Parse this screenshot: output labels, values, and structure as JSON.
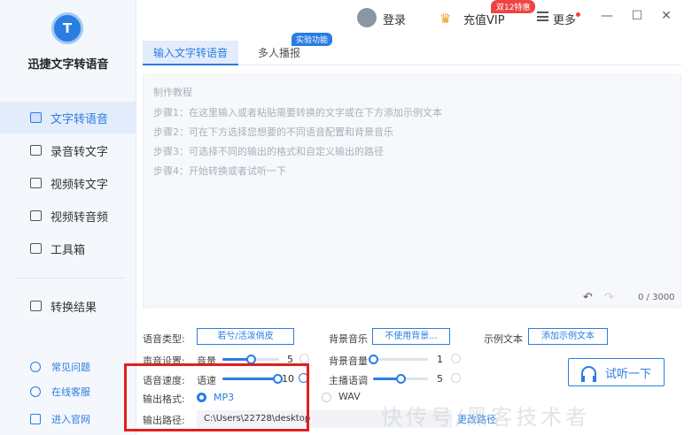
{
  "app": {
    "name": "迅捷文字转语音"
  },
  "sidebar": {
    "items": [
      {
        "label": "文字转语音",
        "icon": "text-to-speech-icon",
        "active": true
      },
      {
        "label": "录音转文字",
        "icon": "recording-to-text-icon"
      },
      {
        "label": "视频转文字",
        "icon": "video-to-text-icon"
      },
      {
        "label": "视频转音频",
        "icon": "video-to-audio-icon"
      },
      {
        "label": "工具箱",
        "icon": "toolbox-icon"
      },
      {
        "label": "转换结果",
        "icon": "results-icon"
      }
    ],
    "footer": [
      {
        "label": "常见问题",
        "icon": "help-icon"
      },
      {
        "label": "在线客服",
        "icon": "headset-icon"
      },
      {
        "label": "进入官网",
        "icon": "monitor-icon"
      }
    ]
  },
  "topbar": {
    "login": "登录",
    "vip": "充值VIP",
    "vip_badge": "双12特惠",
    "more": "更多",
    "window_buttons": [
      "—",
      "☐",
      "✕"
    ]
  },
  "tabs": [
    {
      "label": "输入文字转语音",
      "active": true
    },
    {
      "label": "多人播报"
    }
  ],
  "tab_badge": "实验功能",
  "editor": {
    "hints": [
      "制作教程",
      "步骤1：在这里输入或者粘贴需要转换的文字或在下方添加示例文本",
      "步骤2：可在下方选择您想要的不同语音配置和背景音乐",
      "步骤3：可选择不同的输出的格式和自定义输出的路径",
      "步骤4：开始转换或者试听一下"
    ],
    "counter": "0 / 3000"
  },
  "settings": {
    "voice_type_label": "语音类型:",
    "voice_type_value": "若兮/活泼俏皮",
    "bgm_label": "背景音乐",
    "bgm_value": "不使用背景...",
    "sample_label": "示例文本",
    "sample_button": "添加示例文本",
    "sound_label": "声音设置:",
    "volume_label": "音量",
    "volume_value": "5",
    "volume_level": 0.5,
    "bg_volume_label": "背景音量",
    "bg_volume_value": "1",
    "bg_volume_level": 0.0,
    "speed_section_label": "语音速度:",
    "speed_label": "语速",
    "speed_value": "10",
    "speed_level": 1.0,
    "pitch_label": "主播语调",
    "pitch_value": "5",
    "pitch_level": 0.5,
    "format_label": "输出格式:",
    "format_options": [
      "MP3",
      "WAV"
    ],
    "format_selected": "MP3",
    "path_label": "输出路径:",
    "path_value": "C:\\Users\\22728\\desktop",
    "change_path": "更改路径",
    "listen_button": "试听一下"
  },
  "watermark": "快传号/黑客技术者",
  "colors": {
    "accent": "#2a7de1",
    "highlight": "#e02020",
    "badge": "#f04444",
    "crown": "#e9a21c"
  }
}
